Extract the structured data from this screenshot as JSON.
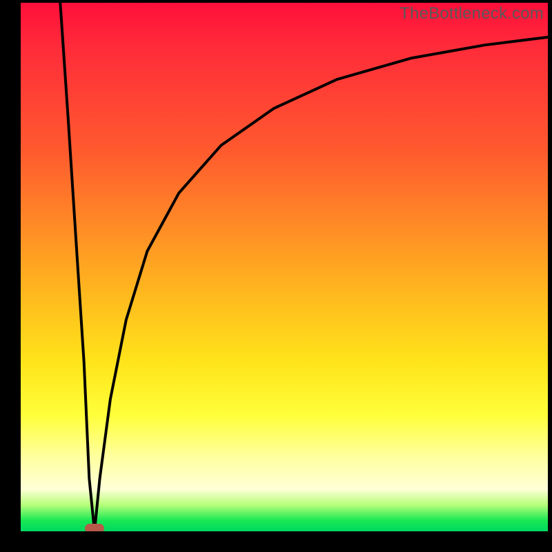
{
  "watermark": "TheBottleneck.com",
  "chart_data": {
    "type": "line",
    "title": "",
    "xlabel": "",
    "ylabel": "",
    "xlim": [
      0,
      100
    ],
    "ylim": [
      0,
      100
    ],
    "grid": false,
    "legend": false,
    "marker": {
      "x": 14,
      "y": 0,
      "color": "#b85a4a"
    },
    "series": [
      {
        "name": "left-branch",
        "x": [
          7.5,
          9,
          10.5,
          12,
          13,
          14
        ],
        "values": [
          100,
          78,
          55,
          32,
          10,
          0
        ]
      },
      {
        "name": "right-branch",
        "x": [
          14,
          15,
          17,
          20,
          24,
          30,
          38,
          48,
          60,
          74,
          88,
          100
        ],
        "values": [
          0,
          10,
          25,
          40,
          53,
          64,
          73,
          80,
          85.5,
          89.5,
          92,
          93.5
        ]
      }
    ],
    "background_gradient": {
      "stops": [
        {
          "pos": 0,
          "color": "#ff0f3a"
        },
        {
          "pos": 8,
          "color": "#ff2a3a"
        },
        {
          "pos": 28,
          "color": "#ff5a2e"
        },
        {
          "pos": 42,
          "color": "#ff8a26"
        },
        {
          "pos": 55,
          "color": "#ffb81e"
        },
        {
          "pos": 68,
          "color": "#ffe41a"
        },
        {
          "pos": 78,
          "color": "#ffff3a"
        },
        {
          "pos": 86,
          "color": "#ffffa0"
        },
        {
          "pos": 92,
          "color": "#ffffd8"
        },
        {
          "pos": 95,
          "color": "#b6ff7a"
        },
        {
          "pos": 98,
          "color": "#17e853"
        },
        {
          "pos": 100,
          "color": "#00d860"
        }
      ]
    }
  }
}
